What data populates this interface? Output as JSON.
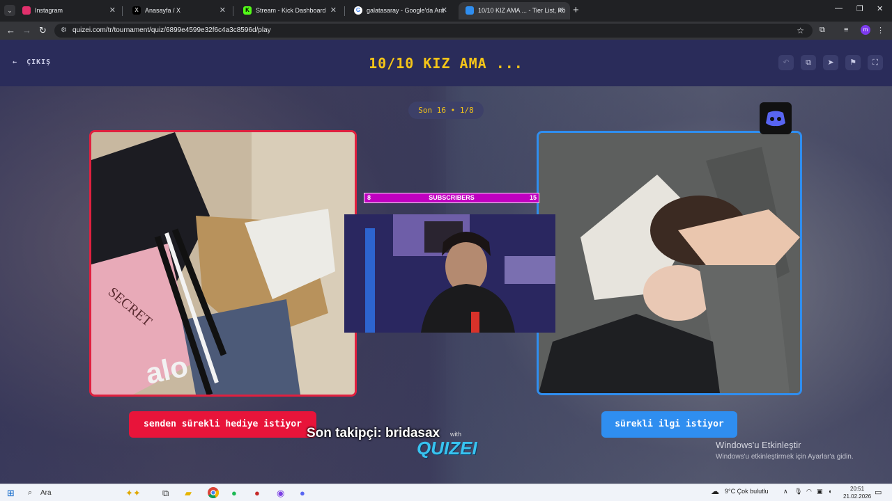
{
  "browser": {
    "tabs": [
      {
        "label": "Instagram",
        "favicon_color": "#e1306c",
        "active": false
      },
      {
        "label": "Anasayfa / X",
        "favicon_color": "#000000",
        "active": false
      },
      {
        "label": "Stream - Kick Dashboard",
        "favicon_color": "#53fc18",
        "active": false
      },
      {
        "label": "galatasaray - Google'da Ara",
        "favicon_color": "#4285f4",
        "active": false
      },
      {
        "label": "10/10 KIZ AMA ... - Tier List, Kö",
        "favicon_color": "#2f8ef0",
        "active": true
      }
    ],
    "url": "quizei.com/tr/tournament/quiz/6899e4599e32f6c4a3c8596d/play",
    "profile_initial": "m"
  },
  "page": {
    "exit_label": "ÇIKIŞ",
    "title": "10/10 KIZ AMA ...",
    "round_label": "Son 16 • 1/8",
    "left_choice": "senden sürekli hediye istiyor",
    "right_choice": "sürekli ilgi istiyor",
    "left_image_text": "SECRET",
    "left_image_brand": "alo",
    "colors": {
      "accent": "#f5c518",
      "left": "#e8143a",
      "right": "#2f8ef0"
    }
  },
  "overlay": {
    "subs_left": "8",
    "subs_label": "SUBSCRIBERS",
    "subs_right": "15",
    "last_follower": "Son takipçi: bridasax",
    "brand_with": "with",
    "brand": "QUIZEI"
  },
  "watermark": {
    "line1": "Windows'u Etkinleştir",
    "line2": "Windows'u etkinleştirmek için Ayarlar'a gidin."
  },
  "taskbar": {
    "search_placeholder": "Ara",
    "weather": "9°C  Çok bulutlu",
    "time": "20:51",
    "date": "21.02.2026"
  }
}
